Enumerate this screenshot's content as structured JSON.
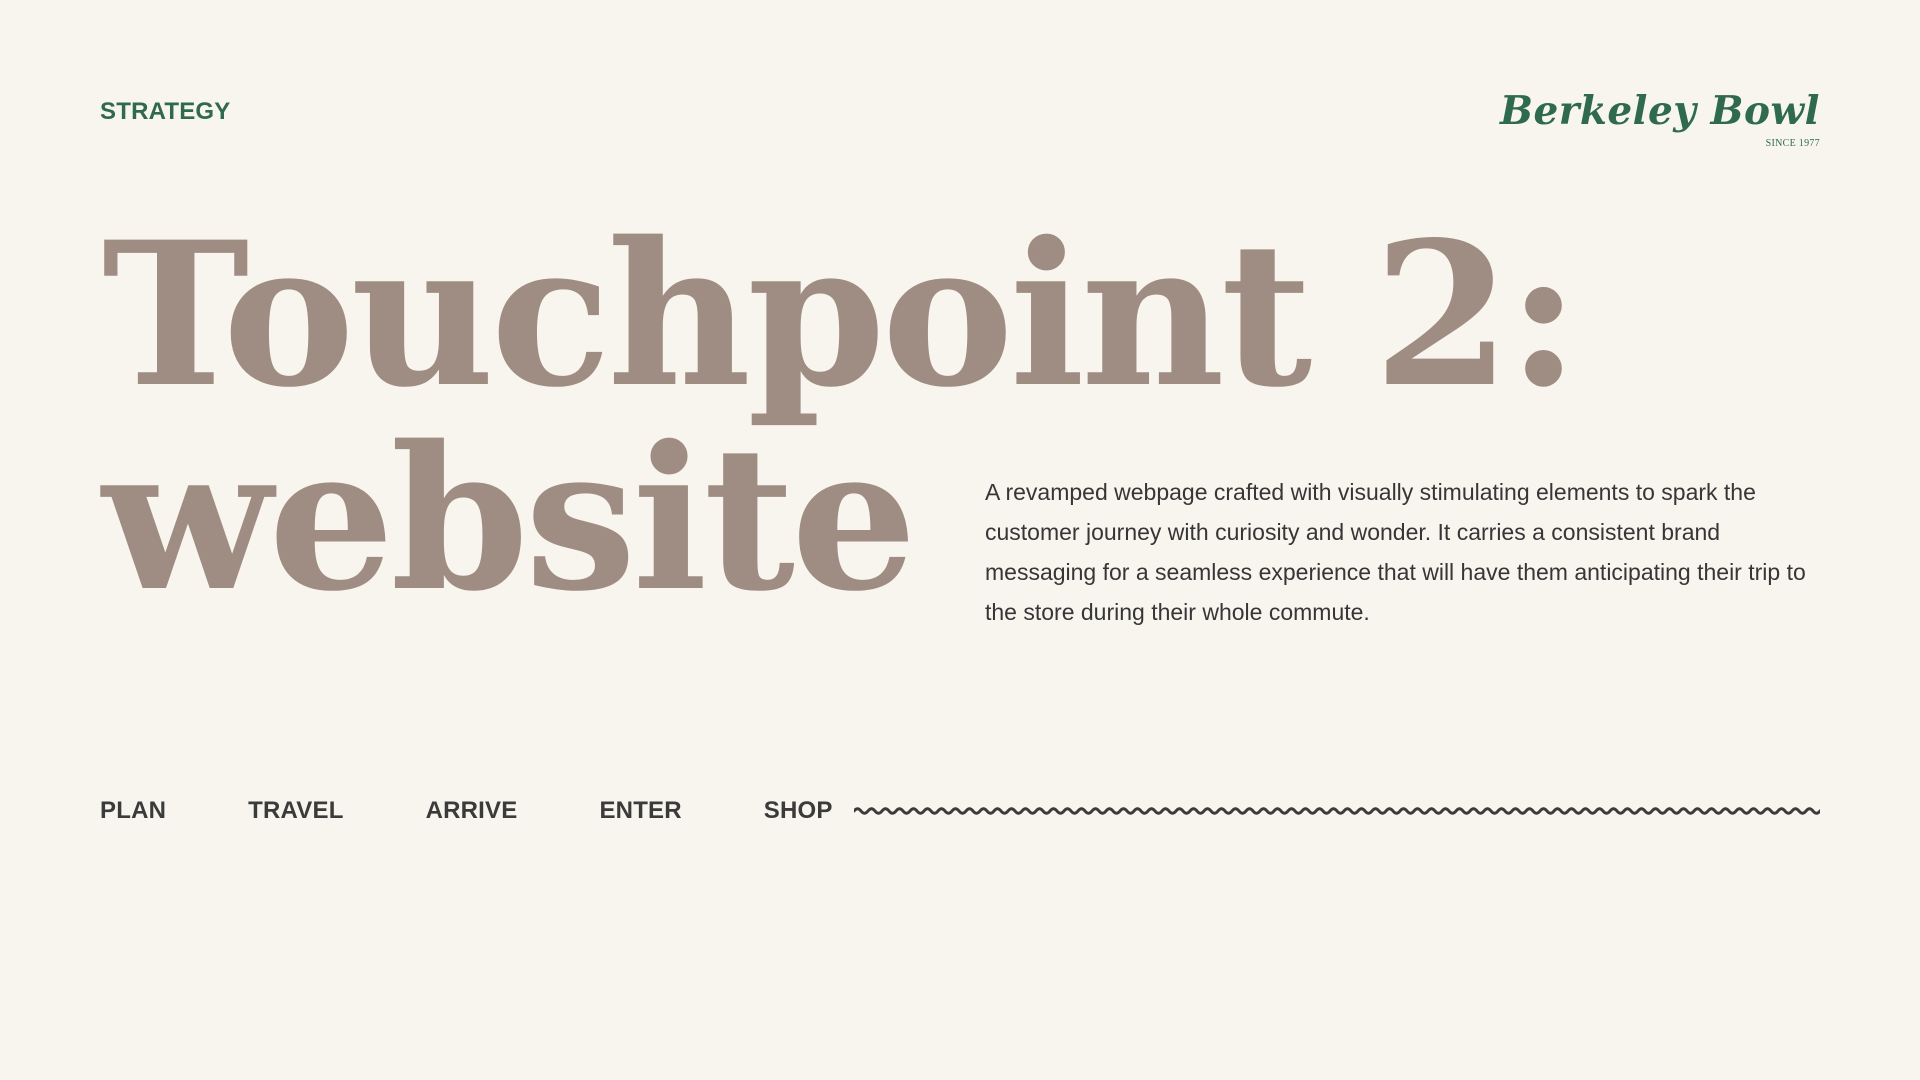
{
  "section": {
    "label": "STRATEGY"
  },
  "brand": {
    "name": "Berkeley Bowl",
    "since": "SINCE 1977",
    "color": "#2f6a4d"
  },
  "headline": {
    "line1": "Touchpoint 2:",
    "line2": "website",
    "color": "#9f8d84"
  },
  "description": "A revamped webpage crafted with visually stimulating elements to spark the customer journey with curiosity and wonder. It carries a consistent brand messaging for a seamless experience that will have them anticipating their trip to the store during their whole commute.",
  "journey_nav": {
    "items": [
      "PLAN",
      "TRAVEL",
      "ARRIVE",
      "ENTER",
      "SHOP"
    ]
  },
  "colors": {
    "background": "#f8f5ee",
    "text_dark": "#3b3b3b",
    "accent": "#2f6a4d"
  },
  "icons": {
    "wave_divider": "wavy-line-divider"
  }
}
